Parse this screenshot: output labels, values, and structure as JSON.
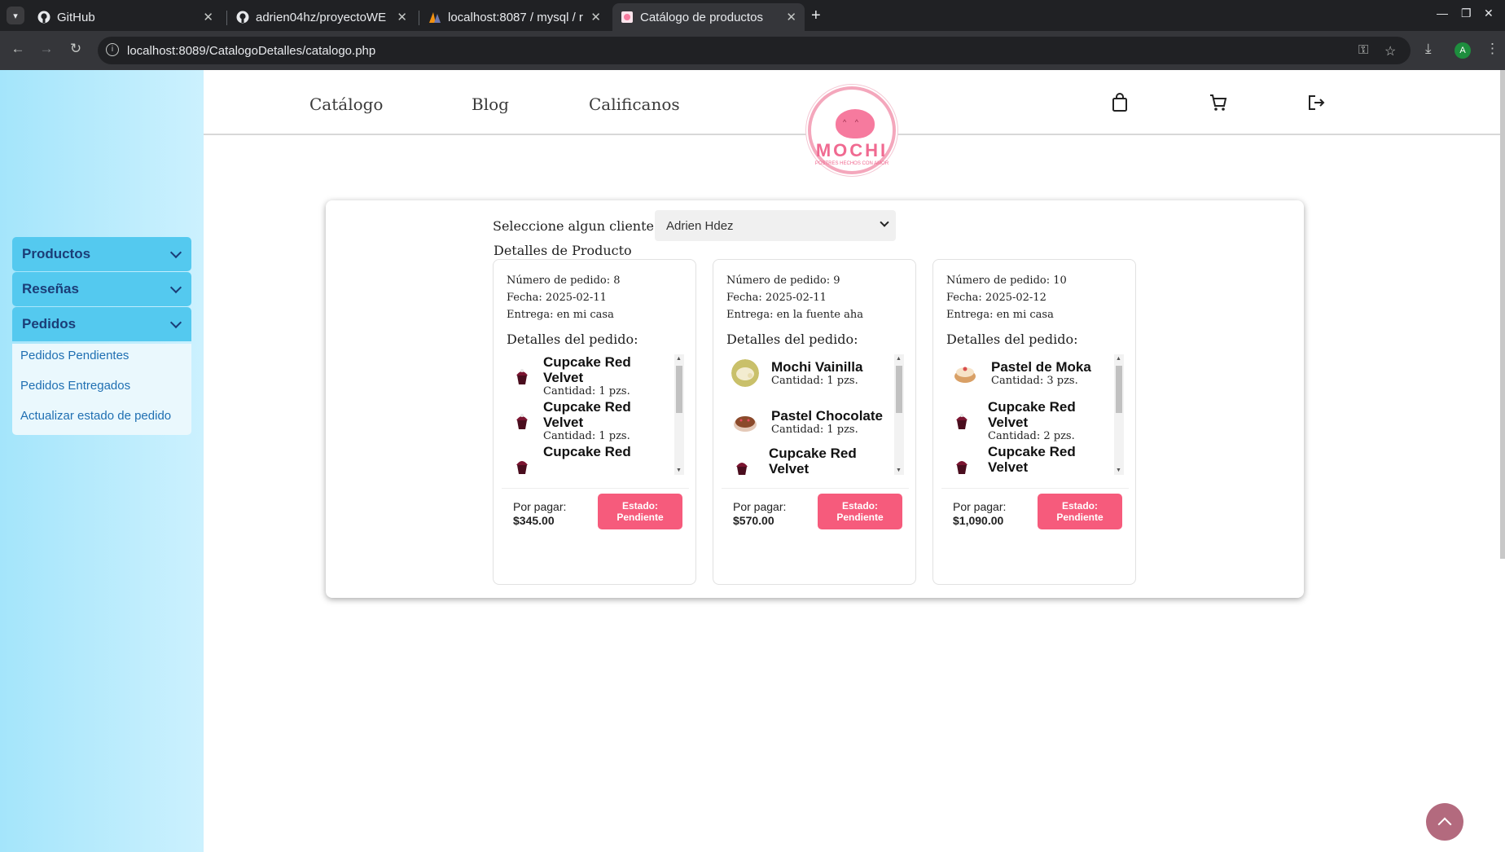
{
  "browser": {
    "tabs": [
      {
        "title": "GitHub",
        "icon": "github-icon"
      },
      {
        "title": "adrien04hz/proyectoWE",
        "icon": "github-icon"
      },
      {
        "title": "localhost:8087 / mysql / r",
        "icon": "phpmyadmin-icon"
      },
      {
        "title": "Catálogo de productos",
        "icon": "page-icon"
      }
    ],
    "url": "localhost:8089/CatalogoDetalles/catalogo.php",
    "profile_initial": "A"
  },
  "sidebar": {
    "menus": [
      {
        "label": "Productos"
      },
      {
        "label": "Reseñas"
      },
      {
        "label": "Pedidos"
      }
    ],
    "submenu": [
      "Pedidos Pendientes",
      "Pedidos Entregados",
      "Actualizar estado de pedido"
    ]
  },
  "topnav": {
    "links": [
      "Catálogo",
      "Blog",
      "Calificanos"
    ],
    "logo_text": "MOCHI",
    "logo_tagline": "POSTRES HECHOS CON AMOR"
  },
  "main": {
    "select_label": "Seleccione algun cliente:",
    "select_value": "Adrien Hdez",
    "details_label": "Detalles de Producto"
  },
  "orders": [
    {
      "numero": "Número de pedido: 8",
      "fecha": "Fecha: 2025-02-11",
      "entrega": "Entrega: en mi casa",
      "detalles": "Detalles del pedido:",
      "items": [
        {
          "name": "Cupcake Red Velvet",
          "qty": "Cantidad: 1 pzs."
        },
        {
          "name": "Cupcake Red Velvet",
          "qty": "Cantidad: 1 pzs."
        },
        {
          "name": "Cupcake Red",
          "qty": ""
        }
      ],
      "por_pagar_label": "Por pagar:",
      "por_pagar": "$345.00",
      "estado": "Estado: Pendiente"
    },
    {
      "numero": "Número de pedido: 9",
      "fecha": "Fecha: 2025-02-11",
      "entrega": "Entrega: en la fuente aha",
      "detalles": "Detalles del pedido:",
      "items": [
        {
          "name": "Mochi Vainilla",
          "qty": "Cantidad: 1 pzs."
        },
        {
          "name": "Pastel Chocolate",
          "qty": "Cantidad: 1 pzs."
        },
        {
          "name": "Cupcake Red Velvet",
          "qty": ""
        }
      ],
      "por_pagar_label": "Por pagar:",
      "por_pagar": "$570.00",
      "estado": "Estado: Pendiente"
    },
    {
      "numero": "Número de pedido: 10",
      "fecha": "Fecha: 2025-02-12",
      "entrega": "Entrega: en mi casa",
      "detalles": "Detalles del pedido:",
      "items": [
        {
          "name": "Pastel de Moka",
          "qty": "Cantidad: 3 pzs."
        },
        {
          "name": "Cupcake Red Velvet",
          "qty": "Cantidad: 2 pzs."
        },
        {
          "name": "Cupcake Red Velvet",
          "qty": ""
        }
      ],
      "por_pagar_label": "Por pagar:",
      "por_pagar": "$1,090.00",
      "estado": "Estado: Pendiente"
    }
  ],
  "colors": {
    "accent": "#f65b7c",
    "sidebar_menu": "#54c9ef",
    "scroll_top": "#b36a7e"
  }
}
